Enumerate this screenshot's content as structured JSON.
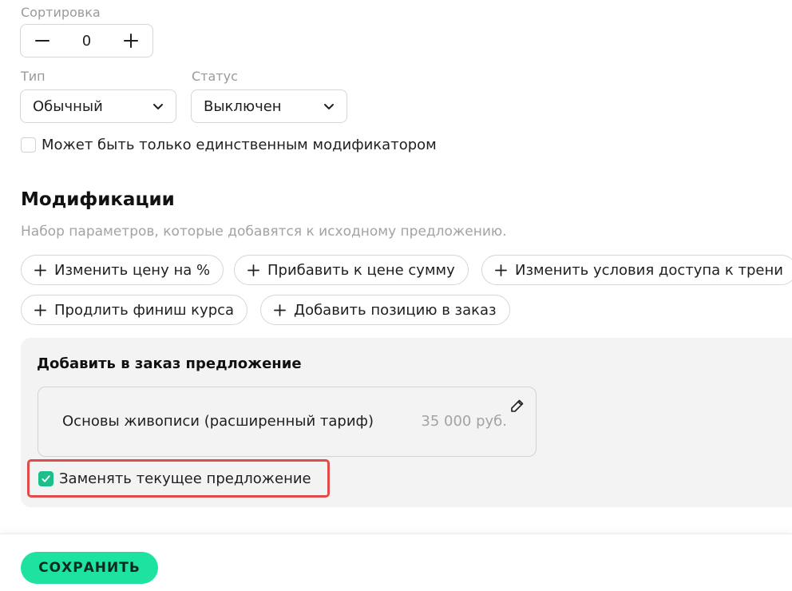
{
  "sort": {
    "label": "Сортировка",
    "value": "0",
    "icons": {
      "decrement": "minus-icon",
      "increment": "plus-icon"
    }
  },
  "type": {
    "label": "Тип",
    "selected": "Обычный"
  },
  "status": {
    "label": "Статус",
    "selected": "Выключен"
  },
  "single_modifier": {
    "label": "Может быть только единственным модификатором",
    "checked": false
  },
  "modifications": {
    "title": "Модификации",
    "description": "Набор параметров, которые добавятся к исходному предложению.",
    "add_buttons": [
      "Изменить цену на %",
      "Прибавить к цене сумму",
      "Изменить условия доступа к трени",
      "Продлить финиш курса",
      "Добавить позицию в заказ"
    ]
  },
  "add_offer_block": {
    "title": "Добавить в заказ предложение",
    "offer": {
      "name": "Основы живописи (расширенный тариф)",
      "price": "35 000 руб."
    },
    "replace_current": {
      "label": "Заменять текущее предложение",
      "checked": true
    }
  },
  "footer": {
    "save_label": "СОХРАНИТЬ"
  },
  "colors": {
    "accent": "#1ee3a0",
    "checkbox_checked": "#1bbf8a",
    "highlight_border": "#e04b4b",
    "panel_bg": "#f3f3f3",
    "muted_text": "#a3a3a3"
  }
}
